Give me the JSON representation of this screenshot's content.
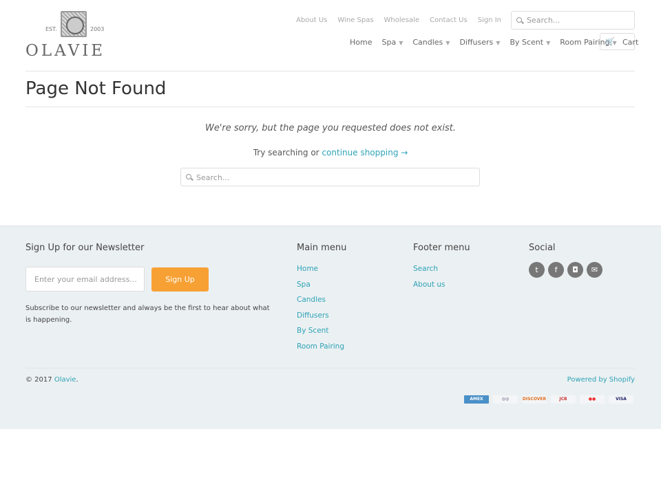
{
  "brand": {
    "name": "OLAVIE",
    "est_left": "EST.",
    "est_right": "2003"
  },
  "top_links": [
    "About Us",
    "Wine Spas",
    "Wholesale",
    "Contact Us",
    "Sign In"
  ],
  "search_top": {
    "placeholder": "Search..."
  },
  "nav": [
    {
      "label": "Home",
      "dropdown": false
    },
    {
      "label": "Spa",
      "dropdown": true
    },
    {
      "label": "Candles",
      "dropdown": true
    },
    {
      "label": "Diffusers",
      "dropdown": true
    },
    {
      "label": "By Scent",
      "dropdown": true
    },
    {
      "label": "Room Pairing",
      "dropdown": true
    }
  ],
  "cart_label": "Cart",
  "page": {
    "title": "Page Not Found",
    "message": "We're sorry, but the page you requested does not exist.",
    "try_text": "Try searching or",
    "continue_link": "continue shopping →",
    "search_placeholder": "Search..."
  },
  "footer": {
    "newsletter": {
      "heading": "Sign Up for our Newsletter",
      "email_placeholder": "Enter your email address...",
      "button": "Sign Up",
      "description": "Subscribe to our newsletter and always be the first to hear about what is happening."
    },
    "main_menu": {
      "heading": "Main menu",
      "items": [
        "Home",
        "Spa",
        "Candles",
        "Diffusers",
        "By Scent",
        "Room Pairing"
      ]
    },
    "footer_menu": {
      "heading": "Footer menu",
      "items": [
        "Search",
        "About us"
      ]
    },
    "social": {
      "heading": "Social",
      "icons": [
        "twitter-icon",
        "facebook-icon",
        "instagram-icon",
        "email-icon"
      ]
    },
    "copyright": "© 2017",
    "copyright_link": "Olavie",
    "powered": "Powered by Shopify",
    "payment_cards": [
      "American Express",
      "Diners",
      "Discover",
      "JCB",
      "Mastercard",
      "Visa"
    ]
  },
  "colors": {
    "accent": "#2ea3b7",
    "button": "#f7a135",
    "footer_bg": "#ebf0f2"
  }
}
